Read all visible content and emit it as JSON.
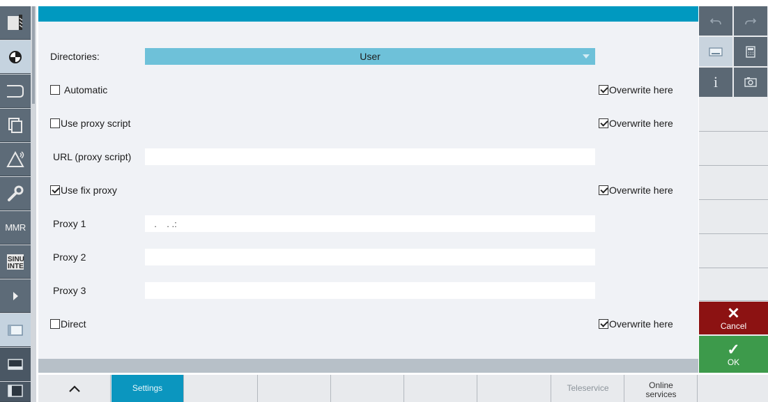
{
  "form": {
    "directories_label": "Directories:",
    "directories_value": "User",
    "automatic_label": "Automatic",
    "automatic_checked": false,
    "use_proxy_script_label": "Use proxy script",
    "use_proxy_script_checked": false,
    "url_proxy_script_label": "URL (proxy script)",
    "url_proxy_script_value": "",
    "use_fix_proxy_label": "Use fix proxy",
    "use_fix_proxy_checked": true,
    "proxy1_label": "Proxy 1",
    "proxy1_value": " .  . .:",
    "proxy2_label": "Proxy 2",
    "proxy2_value": "",
    "proxy3_label": "Proxy 3",
    "proxy3_value": "",
    "direct_label": "Direct",
    "direct_checked": false,
    "overwrite_here_label": "Overwrite here",
    "overwrite_rows_checked": [
      true,
      true,
      true,
      true
    ]
  },
  "left_bar": {
    "mmr_label": "MMR",
    "sinumerik_label": "SINU INTE"
  },
  "bottom_keys": {
    "settings": "Settings",
    "teleservice": "Teleservice",
    "online_services": "Online services"
  },
  "right_keys": {
    "cancel": "Cancel",
    "ok": "OK"
  },
  "icons": {
    "left": [
      "machine-icon",
      "program-icon",
      "program-manager-icon",
      "parameter-icon",
      "diagnostics-icon",
      "setup-icon",
      "mmr-icon",
      "sinumerik-integrate-icon",
      "expand-arrow-icon",
      "window-layout-icon",
      "window-layout-icon",
      "window-layout-icon"
    ],
    "right": [
      "undo-icon",
      "redo-icon",
      "keyboard-icon",
      "calculator-icon",
      "info-icon",
      "screenshot-icon"
    ]
  },
  "colors": {
    "header_blue": "#0099c0",
    "select_blue": "#6ec1d9",
    "cancel_red": "#8c1212",
    "ok_green": "#3d9a4b"
  }
}
